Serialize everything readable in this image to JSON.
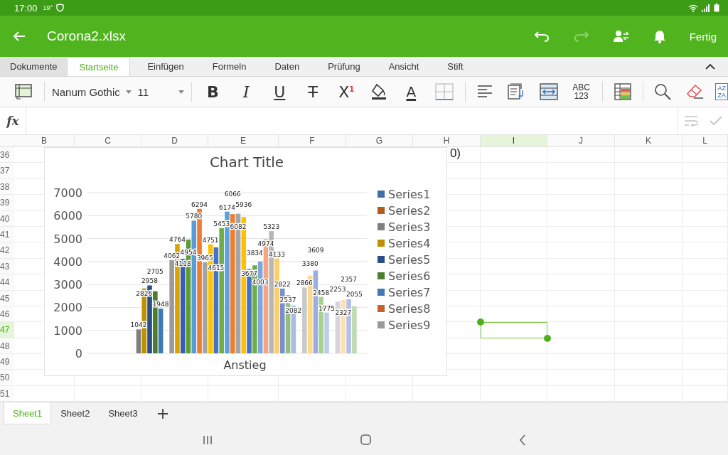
{
  "status_bar": {
    "time": "17:00",
    "temperature": "19°"
  },
  "app_bar": {
    "title": "Corona2.xlsx",
    "redo_disabled": true,
    "done": "Fertig"
  },
  "ribbon_tabs": [
    {
      "label": "Dokumente",
      "selected": false,
      "kind": "file"
    },
    {
      "label": "Startseite",
      "selected": true
    },
    {
      "label": "Einfügen",
      "selected": false
    },
    {
      "label": "Formeln",
      "selected": false
    },
    {
      "label": "Daten",
      "selected": false
    },
    {
      "label": "Prüfung",
      "selected": false
    },
    {
      "label": "Ansicht",
      "selected": false
    },
    {
      "label": "Stift",
      "selected": false
    }
  ],
  "toolbar": [
    {
      "kind": "cell-style"
    },
    {
      "kind": "separator"
    },
    {
      "kind": "font",
      "label": "Nanum Gothic"
    },
    {
      "kind": "size",
      "label": "11"
    },
    {
      "kind": "separator"
    },
    {
      "kind": "bold",
      "label": "B"
    },
    {
      "kind": "italic",
      "label": "I"
    },
    {
      "kind": "underline",
      "label": "U"
    },
    {
      "kind": "strike",
      "label": "T"
    },
    {
      "kind": "superscript",
      "label": "X",
      "mark": "1"
    },
    {
      "kind": "fill"
    },
    {
      "kind": "font-color",
      "label": "A"
    },
    {
      "kind": "borders"
    },
    {
      "kind": "separator"
    },
    {
      "kind": "align"
    },
    {
      "kind": "wrap"
    },
    {
      "kind": "merge"
    },
    {
      "kind": "number-format",
      "label": "ABC",
      "mark": "123"
    },
    {
      "kind": "separator"
    },
    {
      "kind": "conditional"
    },
    {
      "kind": "separator"
    },
    {
      "kind": "search"
    },
    {
      "kind": "clear"
    },
    {
      "kind": "sort",
      "label": "AZ",
      "mark": "ZA"
    }
  ],
  "formula_bar": {
    "label": "fx",
    "confirm_disabled": true
  },
  "columns": [
    {
      "label": "B",
      "selected": false
    },
    {
      "label": "C",
      "selected": false
    },
    {
      "label": "D",
      "selected": false
    },
    {
      "label": "E",
      "selected": false
    },
    {
      "label": "F",
      "selected": false
    },
    {
      "label": "G",
      "selected": false
    },
    {
      "label": "H",
      "selected": false
    },
    {
      "label": "I",
      "selected": true
    },
    {
      "label": "J",
      "selected": false
    },
    {
      "label": "K",
      "selected": false
    },
    {
      "label": "L",
      "selected": false
    }
  ],
  "rows": [
    {
      "label": "36",
      "selected": false,
      "text": "0)"
    },
    {
      "label": "37",
      "selected": false
    },
    {
      "label": "38",
      "selected": false
    },
    {
      "label": "39",
      "selected": false
    },
    {
      "label": "40",
      "selected": false
    },
    {
      "label": "41",
      "selected": false
    },
    {
      "label": "42",
      "selected": false
    },
    {
      "label": "43",
      "selected": false
    },
    {
      "label": "44",
      "selected": false
    },
    {
      "label": "45",
      "selected": false
    },
    {
      "label": "46",
      "selected": false
    },
    {
      "label": "47",
      "selected": true
    },
    {
      "label": "48",
      "selected": false
    },
    {
      "label": "49",
      "selected": false
    },
    {
      "label": "50",
      "selected": false
    },
    {
      "label": "51",
      "selected": false
    }
  ],
  "chart": {
    "chart_data": {
      "type": "bar",
      "title": "Chart Title",
      "categories": [
        "Anstieg"
      ],
      "ylim": [
        0,
        7000
      ],
      "grid": true,
      "legend": true,
      "yticks": [
        0,
        1000,
        2000,
        3000,
        4000,
        5000,
        6000,
        7000
      ],
      "data_labels": true,
      "series": [
        {
          "name": "Series1",
          "color": "#3e6fa6",
          "values": [
            null
          ]
        },
        {
          "name": "Series2",
          "color": "#b35a1f",
          "values": [
            null
          ]
        },
        {
          "name": "Series3",
          "color": "#7f7f7f",
          "values": [
            1042
          ]
        },
        {
          "name": "Series4",
          "color": "#bf9000",
          "values": [
            2826
          ]
        },
        {
          "name": "Series5",
          "color": "#264f8c",
          "values": [
            2958
          ]
        },
        {
          "name": "Series6",
          "color": "#4e7d2e",
          "values": [
            2705
          ]
        },
        {
          "name": "Series7",
          "color": "#3f7ab5",
          "values": [
            1948
          ]
        },
        {
          "name": "Series8",
          "color": "#c8602a",
          "values": [
            null
          ]
        },
        {
          "name": "Series9",
          "color": "#9a9a9a",
          "values": [
            4062
          ]
        },
        {
          "color": "#d9a400",
          "values": [
            4764
          ]
        },
        {
          "color": "#3a5fb0",
          "values": [
            4118
          ]
        },
        {
          "color": "#5e9a3a",
          "values": [
            4954
          ]
        },
        {
          "color": "#5b9bd5",
          "values": [
            5780
          ]
        },
        {
          "color": "#ed7d31",
          "values": [
            6294
          ]
        },
        {
          "color": "#a5a5a5",
          "values": [
            3965
          ]
        },
        {
          "color": "#ffc000",
          "values": [
            4751
          ]
        },
        {
          "color": "#4472c4",
          "values": [
            4615
          ]
        },
        {
          "color": "#70ad47",
          "values": [
            5453
          ]
        },
        {
          "color": "#5ba3e0",
          "values": [
            6174
          ]
        },
        {
          "color": "#ed7d31",
          "values": [
            6066
          ]
        },
        {
          "color": "#a5a5a5",
          "values": [
            6082
          ]
        },
        {
          "color": "#ffc000",
          "values": [
            5936
          ]
        },
        {
          "color": "#4472c4",
          "values": [
            3677
          ]
        },
        {
          "color": "#70ad47",
          "values": [
            3834
          ]
        },
        {
          "color": "#7ea6dc",
          "values": [
            4003
          ]
        },
        {
          "color": "#f4a582",
          "values": [
            4974
          ]
        },
        {
          "color": "#b7b7b7",
          "values": [
            5323
          ]
        },
        {
          "color": "#ffcd66",
          "values": [
            4133
          ]
        },
        {
          "color": "#7a8fcf",
          "values": [
            2822
          ]
        },
        {
          "color": "#93bf7a",
          "values": [
            2537
          ]
        },
        {
          "color": "#a3bfe6",
          "values": [
            2082
          ]
        },
        {
          "values": [
            null
          ]
        },
        {
          "color": "#c9c9c9",
          "values": [
            2866
          ]
        },
        {
          "color": "#ffd98a",
          "values": [
            3380
          ]
        },
        {
          "color": "#9aaee0",
          "values": [
            3609
          ]
        },
        {
          "color": "#a9d18e",
          "values": [
            2458
          ]
        },
        {
          "color": "#bccde9",
          "values": [
            1775
          ]
        },
        {
          "values": [
            null
          ]
        },
        {
          "color": "#d9d4dc",
          "values": [
            2253
          ]
        },
        {
          "color": "#ffe0b0",
          "values": [
            2327
          ]
        },
        {
          "color": "#b4c0e6",
          "values": [
            2357
          ]
        },
        {
          "color": "#bedcb0",
          "values": [
            2055
          ]
        }
      ]
    }
  },
  "sheet_tabs": [
    {
      "label": "Sheet1",
      "selected": true
    },
    {
      "label": "Sheet2",
      "selected": false
    },
    {
      "label": "Sheet3",
      "selected": false
    }
  ]
}
